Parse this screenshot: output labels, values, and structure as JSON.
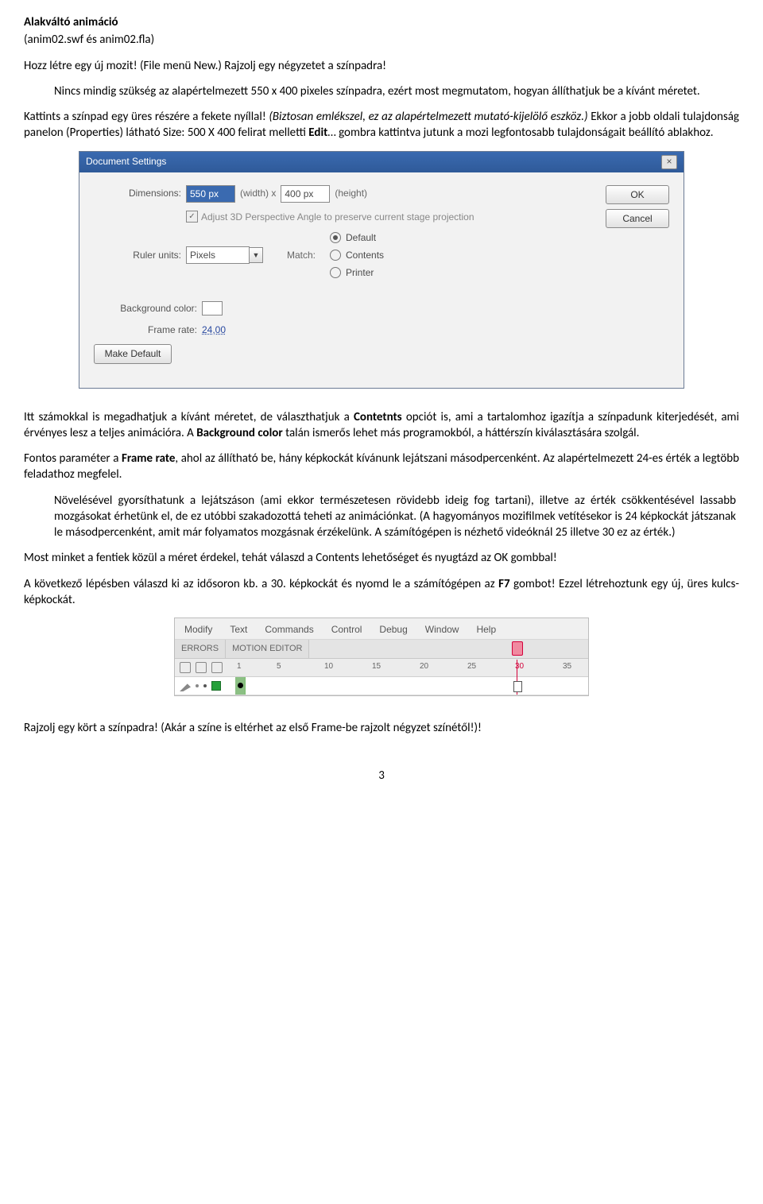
{
  "header": {
    "title": "Alakváltó animáció",
    "subtitle": "(anim02.swf és anim02.fla)"
  },
  "para1": "Hozz létre egy új mozit! (File menü New.) Rajzolj egy négyzetet a színpadra!",
  "para2": "Nincs mindig szükség az alapértelmezett 550 x 400 pixeles színpadra, ezért most megmutatom, hogyan állíthatjuk be a kívánt méretet.",
  "para3_a": "Kattints a színpad egy üres részére a fekete nyíllal! ",
  "para3_b": "(Biztosan emlékszel, ez az alapértelmezett mutató-kijelölő eszköz.)",
  "para3_c": " Ekkor a jobb oldali tulajdonság panelon (Properties) látható Size: 500 X 400 felirat melletti ",
  "para3_d": "Edit",
  "para3_e": "… gombra kattintva jutunk a mozi legfontosabb tulajdonságait beállító ablakhoz.",
  "dialog": {
    "title": "Document Settings",
    "dimensions_label": "Dimensions:",
    "dim_w": "550 px",
    "width_x": "(width) x",
    "dim_h": "400 px",
    "height_txt": "(height)",
    "adjust3d": "Adjust 3D Perspective Angle to preserve current stage projection",
    "ruler_label": "Ruler units:",
    "ruler_value": "Pixels",
    "match_label": "Match:",
    "match_opts": [
      "Default",
      "Contents",
      "Printer"
    ],
    "bg_label": "Background color:",
    "fr_label": "Frame rate:",
    "fr_value": "24,00",
    "make_default": "Make Default",
    "ok": "OK",
    "cancel": "Cancel"
  },
  "para4_a": "Itt számokkal is megadhatjuk a kívánt méretet, de választhatjuk a ",
  "para4_b": "Contetnts",
  "para4_c": " opciót is, ami a tartalomhoz igazítja a színpadunk kiterjedését, ami érvényes lesz a teljes animációra.  A ",
  "para4_d": "Background color",
  "para4_e": " talán ismerős lehet más programokból, a háttérszín kiválasztására szolgál.",
  "para5_a": "Fontos paraméter a ",
  "para5_b": "Frame rate",
  "para5_c": ", ahol az állítható be, hány képkockát kívánunk lejátszani másodpercenként. Az alapértelmezett 24-es érték a legtöbb feladathoz megfelel.",
  "para6": "Növelésével gyorsíthatunk a lejátszáson (ami ekkor természetesen rövidebb ideig fog tartani), illetve az érték csökkentésével lassabb mozgásokat érhetünk el, de ez utóbbi szakadozottá teheti az animációnkat.  (A hagyományos mozifilmek vetítésekor is 24 képkockát játszanak le másodpercenként, amit már folyamatos mozgásnak érzékelünk. A számítógépen is nézhető videóknál 25 illetve 30 ez az érték.)",
  "para7": "Most minket a fentiek közül a méret érdekel, tehát válaszd a Contents lehetőséget és nyugtázd az OK gombbal!",
  "para8_a": "A következő lépésben válaszd ki az idősoron kb. a 30. képkockát és nyomd le a számítógépen az ",
  "para8_b": "F7",
  "para8_c": " gombot! Ezzel létrehoztunk egy új, üres kulcs-képkockát.",
  "timeline": {
    "menus": [
      "Modify",
      "Text",
      "Commands",
      "Control",
      "Debug",
      "Window",
      "Help"
    ],
    "tabs": [
      "ERRORS",
      "MOTION EDITOR"
    ],
    "ticks": [
      "1",
      "5",
      "10",
      "15",
      "20",
      "25",
      "30",
      "35"
    ]
  },
  "para9": "Rajzolj egy kört a színpadra! (Akár a színe is eltérhet az első Frame-be rajzolt négyzet színétől!)!",
  "page_number": "3"
}
